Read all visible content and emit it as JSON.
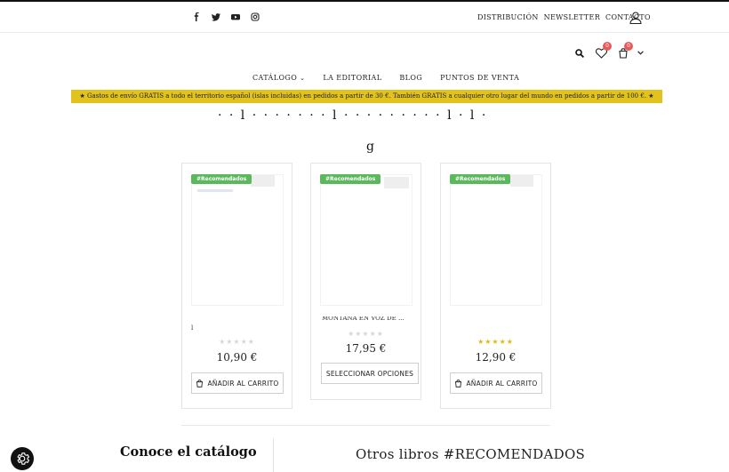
{
  "header": {
    "social": [
      "facebook-icon",
      "twitter-icon",
      "youtube-icon",
      "instagram-icon"
    ],
    "links": [
      "DISTRIBUCIÓN",
      "NEWSLETTER",
      "CONTACTO"
    ],
    "wishlist_count": "0",
    "cart_count": "0"
  },
  "nav": {
    "items": [
      "CATÁLOGO",
      "LA EDITORIAL",
      "BLOG",
      "PUNTOS DE VENTA"
    ]
  },
  "banner": {
    "text": "★ Gastos de envío GRATIS a todo el territorio español (islas incluidas) en pedidos a partir de 30 €. También GRATIS a cualquier otro lugar del mundo en pedidos a partir de 100 €. ★"
  },
  "products": [
    {
      "tag": "#Recomendados",
      "name": "l",
      "rating": 0,
      "stars": "★★★★★",
      "price": "10,90 €",
      "button": "AÑADIR AL CARRITO"
    },
    {
      "tag": "#Recomendados",
      "name": "MONTAÑA EN VOZ DE ...",
      "rating": 0,
      "stars": "★★★★★",
      "price": "17,95 €",
      "button": "SELECCIONAR OPCIONES"
    },
    {
      "tag": "#Recomendados",
      "name": "",
      "rating": 5,
      "stars": "★★★★★",
      "price": "12,90 €",
      "button": "AÑADIR AL CARRITO"
    }
  ],
  "footer": {
    "left_title": "Conoce el catálogo",
    "right_title": "Otros libros #RECOMENDADOS"
  },
  "colors": {
    "banner": "#e2c21c",
    "tag": "#5cb85c",
    "badge": "#e85a5a",
    "star_full": "#e0b810"
  }
}
